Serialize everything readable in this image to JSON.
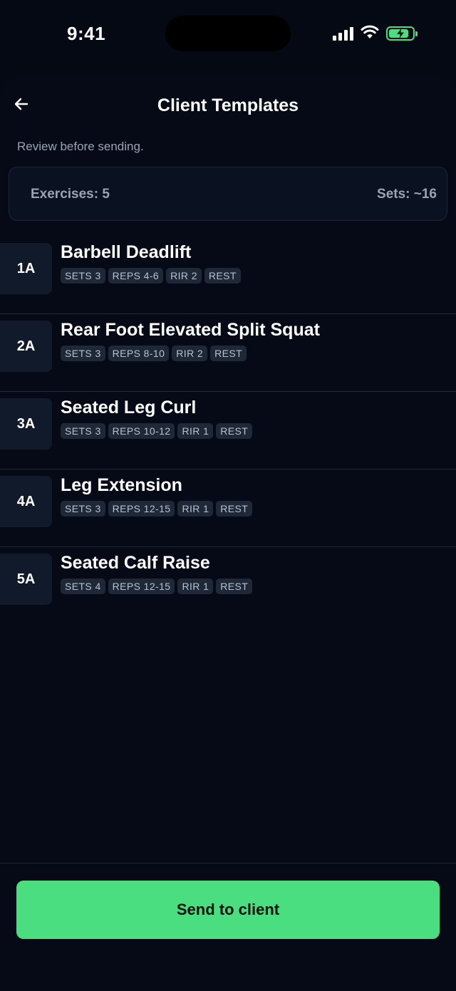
{
  "status_bar": {
    "time": "9:41",
    "battery_level": 0.85,
    "battery_color": "#4ade80",
    "icons": [
      "cellular-signal-icon",
      "wifi-icon",
      "battery-charging-icon"
    ]
  },
  "header": {
    "back_icon": "arrow-left-icon",
    "title": "Client Templates"
  },
  "subtitle": "Review before sending.",
  "summary": {
    "exercises": "Exercises: 5",
    "sets": "Sets: ~16"
  },
  "exercises": [
    {
      "order": "1A",
      "name": "Barbell Deadlift",
      "sets": "SETS 3",
      "reps": "REPS 4-6",
      "rir": "RIR 2",
      "rest": "REST"
    },
    {
      "order": "2A",
      "name": "Rear Foot Elevated Split Squat",
      "sets": "SETS 3",
      "reps": "REPS 8-10",
      "rir": "RIR 2",
      "rest": "REST"
    },
    {
      "order": "3A",
      "name": "Seated Leg Curl",
      "sets": "SETS 3",
      "reps": "REPS 10-12",
      "rir": "RIR 1",
      "rest": "REST"
    },
    {
      "order": "4A",
      "name": "Leg Extension",
      "sets": "SETS 3",
      "reps": "REPS 12-15",
      "rir": "RIR 1",
      "rest": "REST"
    },
    {
      "order": "5A",
      "name": "Seated Calf Raise",
      "sets": "SETS 4",
      "reps": "REPS 12-15",
      "rir": "RIR 1",
      "rest": "REST"
    }
  ],
  "footer": {
    "send_label": "Send to client"
  },
  "colors": {
    "background": "#050914",
    "accent": "#4ade80",
    "chip_bg": "#1f2837",
    "badge_bg": "#111a2a"
  }
}
